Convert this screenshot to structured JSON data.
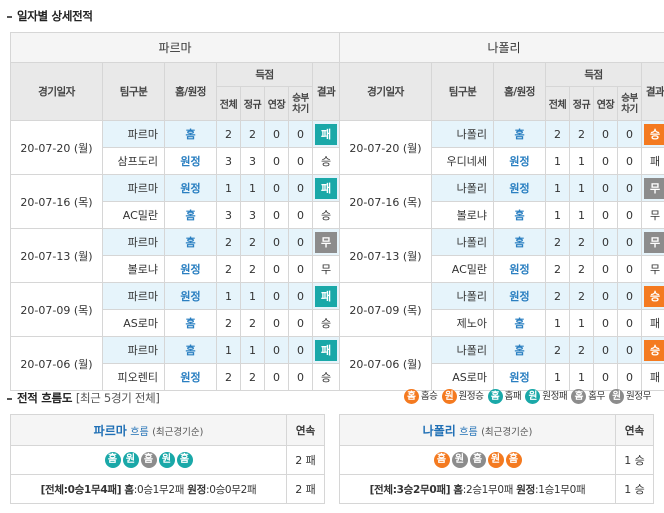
{
  "section_title": "일자별 상세전적",
  "headers": {
    "date": "경기일자",
    "team": "팀구분",
    "home_away": "홈/원정",
    "score": "득점",
    "total": "전체",
    "regular": "정규",
    "extra": "연장",
    "shootout": "승부차기",
    "result": "결과"
  },
  "teams": [
    {
      "name": "파르마",
      "matches": [
        {
          "date": "20-07-20 (월)",
          "rows": [
            {
              "club": "파르마",
              "ha": "홈",
              "total": "2",
              "reg": "2",
              "ext": "0",
              "pk": "0",
              "result": "패",
              "res_type": "loss",
              "hl": true
            },
            {
              "club": "삼프도리",
              "ha": "원정",
              "total": "3",
              "reg": "3",
              "ext": "0",
              "pk": "0",
              "result": "승",
              "res_type": "text",
              "hl": false
            }
          ]
        },
        {
          "date": "20-07-16 (목)",
          "rows": [
            {
              "club": "파르마",
              "ha": "원정",
              "total": "1",
              "reg": "1",
              "ext": "0",
              "pk": "0",
              "result": "패",
              "res_type": "loss",
              "hl": true
            },
            {
              "club": "AC밀란",
              "ha": "홈",
              "total": "3",
              "reg": "3",
              "ext": "0",
              "pk": "0",
              "result": "승",
              "res_type": "text",
              "hl": false
            }
          ]
        },
        {
          "date": "20-07-13 (월)",
          "rows": [
            {
              "club": "파르마",
              "ha": "홈",
              "total": "2",
              "reg": "2",
              "ext": "0",
              "pk": "0",
              "result": "무",
              "res_type": "draw",
              "hl": true
            },
            {
              "club": "볼로냐",
              "ha": "원정",
              "total": "2",
              "reg": "2",
              "ext": "0",
              "pk": "0",
              "result": "무",
              "res_type": "text",
              "hl": false
            }
          ]
        },
        {
          "date": "20-07-09 (목)",
          "rows": [
            {
              "club": "파르마",
              "ha": "원정",
              "total": "1",
              "reg": "1",
              "ext": "0",
              "pk": "0",
              "result": "패",
              "res_type": "loss",
              "hl": true
            },
            {
              "club": "AS로마",
              "ha": "홈",
              "total": "2",
              "reg": "2",
              "ext": "0",
              "pk": "0",
              "result": "승",
              "res_type": "text",
              "hl": false
            }
          ]
        },
        {
          "date": "20-07-06 (월)",
          "rows": [
            {
              "club": "파르마",
              "ha": "홈",
              "total": "1",
              "reg": "1",
              "ext": "0",
              "pk": "0",
              "result": "패",
              "res_type": "loss",
              "hl": true
            },
            {
              "club": "피오렌티",
              "ha": "원정",
              "total": "2",
              "reg": "2",
              "ext": "0",
              "pk": "0",
              "result": "승",
              "res_type": "text",
              "hl": false
            }
          ]
        }
      ]
    },
    {
      "name": "나폴리",
      "matches": [
        {
          "date": "20-07-20 (월)",
          "rows": [
            {
              "club": "나폴리",
              "ha": "홈",
              "total": "2",
              "reg": "2",
              "ext": "0",
              "pk": "0",
              "result": "승",
              "res_type": "win",
              "hl": true
            },
            {
              "club": "우디네세",
              "ha": "원정",
              "total": "1",
              "reg": "1",
              "ext": "0",
              "pk": "0",
              "result": "패",
              "res_type": "text",
              "hl": false
            }
          ]
        },
        {
          "date": "20-07-16 (목)",
          "rows": [
            {
              "club": "나폴리",
              "ha": "원정",
              "total": "1",
              "reg": "1",
              "ext": "0",
              "pk": "0",
              "result": "무",
              "res_type": "draw",
              "hl": true
            },
            {
              "club": "볼로냐",
              "ha": "홈",
              "total": "1",
              "reg": "1",
              "ext": "0",
              "pk": "0",
              "result": "무",
              "res_type": "text",
              "hl": false
            }
          ]
        },
        {
          "date": "20-07-13 (월)",
          "rows": [
            {
              "club": "나폴리",
              "ha": "홈",
              "total": "2",
              "reg": "2",
              "ext": "0",
              "pk": "0",
              "result": "무",
              "res_type": "draw",
              "hl": true
            },
            {
              "club": "AC밀란",
              "ha": "원정",
              "total": "2",
              "reg": "2",
              "ext": "0",
              "pk": "0",
              "result": "무",
              "res_type": "text",
              "hl": false
            }
          ]
        },
        {
          "date": "20-07-09 (목)",
          "rows": [
            {
              "club": "나폴리",
              "ha": "원정",
              "total": "2",
              "reg": "2",
              "ext": "0",
              "pk": "0",
              "result": "승",
              "res_type": "win",
              "hl": true
            },
            {
              "club": "제노아",
              "ha": "홈",
              "total": "1",
              "reg": "1",
              "ext": "0",
              "pk": "0",
              "result": "패",
              "res_type": "text",
              "hl": false
            }
          ]
        },
        {
          "date": "20-07-06 (월)",
          "rows": [
            {
              "club": "나폴리",
              "ha": "홈",
              "total": "2",
              "reg": "2",
              "ext": "0",
              "pk": "0",
              "result": "승",
              "res_type": "win",
              "hl": true
            },
            {
              "club": "AS로마",
              "ha": "원정",
              "total": "1",
              "reg": "1",
              "ext": "0",
              "pk": "0",
              "result": "패",
              "res_type": "text",
              "hl": false
            }
          ]
        }
      ]
    }
  ],
  "flow": {
    "title": "전적 흐름도",
    "subtitle": "[최근 5경기 전체]",
    "legend": [
      {
        "glyph": "홈",
        "label": "홈승",
        "type": "win"
      },
      {
        "glyph": "원",
        "label": "원정승",
        "type": "win"
      },
      {
        "glyph": "홈",
        "label": "홈패",
        "type": "loss"
      },
      {
        "glyph": "원",
        "label": "원정패",
        "type": "loss-alt"
      },
      {
        "glyph": "홈",
        "label": "홈무",
        "type": "draw"
      },
      {
        "glyph": "원",
        "label": "원정무",
        "type": "draw"
      }
    ],
    "streak_header": "연속",
    "flow_label": "흐름",
    "flow_sub": "(최근경기순)",
    "teams": [
      {
        "name": "파르마",
        "dots": [
          {
            "g": "홈",
            "t": "loss"
          },
          {
            "g": "원",
            "t": "loss"
          },
          {
            "g": "홈",
            "t": "draw"
          },
          {
            "g": "원",
            "t": "loss"
          },
          {
            "g": "홈",
            "t": "loss"
          }
        ],
        "streak": "2 패",
        "summary_total": "[전체:0승1무4패]",
        "summary_home_label": "홈",
        "summary_home": ":0승1무2패",
        "summary_away_label": "원정",
        "summary_away": ":0승0무2패",
        "summary_streak": "2 패"
      },
      {
        "name": "나폴리",
        "dots": [
          {
            "g": "홈",
            "t": "win"
          },
          {
            "g": "원",
            "t": "draw"
          },
          {
            "g": "홈",
            "t": "draw"
          },
          {
            "g": "원",
            "t": "win"
          },
          {
            "g": "홈",
            "t": "win"
          }
        ],
        "streak": "1 승",
        "summary_total": "[전체:3승2무0패]",
        "summary_home_label": "홈",
        "summary_home": ":2승1무0패",
        "summary_away_label": "원정",
        "summary_away": ":1승1무0패",
        "summary_streak": "1 승"
      }
    ]
  },
  "colors": {
    "win": "#f47a20",
    "loss": "#1aa8a8",
    "draw": "#8c8c8c",
    "accent": "#1f6fb5"
  }
}
